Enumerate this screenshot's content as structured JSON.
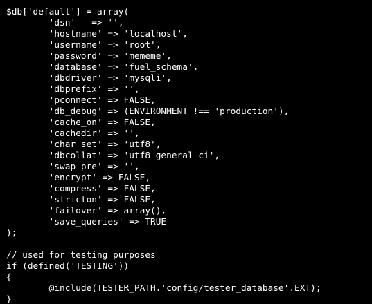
{
  "editor": {
    "background": "#000000",
    "text_color": "#ffffff",
    "lines": [
      "$db['default'] = array(",
      "\t'dsn'\t=> '',",
      "\t'hostname' => 'localhost',",
      "\t'username' => 'root',",
      "\t'password' => 'mememe',",
      "\t'database' => 'fuel_schema',",
      "\t'dbdriver' => 'mysqli',",
      "\t'dbprefix' => '',",
      "\t'pconnect' => FALSE,",
      "\t'db_debug' => (ENVIRONMENT !== 'production'),",
      "\t'cache_on' => FALSE,",
      "\t'cachedir' => '',",
      "\t'char_set' => 'utf8',",
      "\t'dbcollat' => 'utf8_general_ci',",
      "\t'swap_pre' => '',",
      "\t'encrypt' => FALSE,",
      "\t'compress' => FALSE,",
      "\t'stricton' => FALSE,",
      "\t'failover' => array(),",
      "\t'save_queries' => TRUE",
      ");",
      "",
      "// used for testing purposes",
      "if (defined('TESTING'))",
      "{",
      "\t@include(TESTER_PATH.'config/tester_database'.EXT);",
      "}"
    ]
  }
}
